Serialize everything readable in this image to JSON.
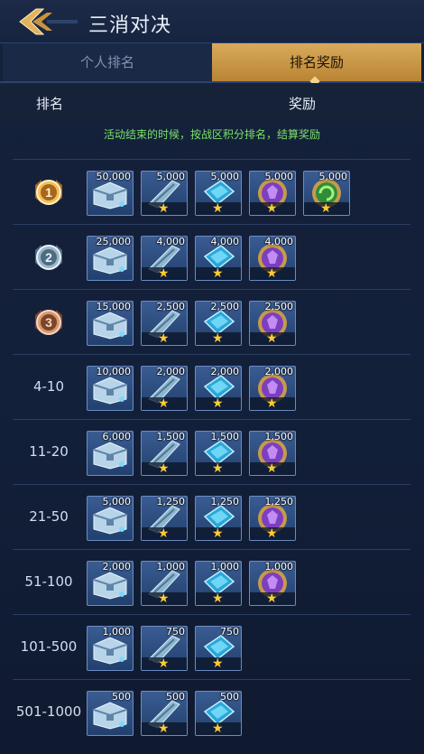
{
  "header": {
    "title": "三消对决",
    "back_icon": "back-arrow-icon"
  },
  "tabs": [
    {
      "label": "个人排名",
      "active": false
    },
    {
      "label": "排名奖励",
      "active": true
    }
  ],
  "columns": {
    "rank": "排名",
    "reward": "奖励"
  },
  "notice": "活动结束的时候，按战区积分排名，结算奖励",
  "colors": {
    "accent_gold": "#c8974a",
    "notice_green": "#7be06a",
    "star": "#ffcc33"
  },
  "rows": [
    {
      "rank": "1",
      "medal": "gold-medal-icon",
      "rewards": [
        {
          "icon": "treasure-chest-icon",
          "qty": "50,000",
          "star": false
        },
        {
          "icon": "wing-fragment-icon",
          "qty": "5,000",
          "star": true
        },
        {
          "icon": "blue-crystal-icon",
          "qty": "5,000",
          "star": true
        },
        {
          "icon": "purple-gem-icon",
          "qty": "5,000",
          "star": true
        },
        {
          "icon": "green-orb-icon",
          "qty": "5,000",
          "star": true
        }
      ]
    },
    {
      "rank": "2",
      "medal": "silver-medal-icon",
      "rewards": [
        {
          "icon": "treasure-chest-icon",
          "qty": "25,000",
          "star": false
        },
        {
          "icon": "wing-fragment-icon",
          "qty": "4,000",
          "star": true
        },
        {
          "icon": "blue-crystal-icon",
          "qty": "4,000",
          "star": true
        },
        {
          "icon": "purple-gem-icon",
          "qty": "4,000",
          "star": true
        }
      ]
    },
    {
      "rank": "3",
      "medal": "bronze-medal-icon",
      "rewards": [
        {
          "icon": "treasure-chest-icon",
          "qty": "15,000",
          "star": false
        },
        {
          "icon": "wing-fragment-icon",
          "qty": "2,500",
          "star": true
        },
        {
          "icon": "blue-crystal-icon",
          "qty": "2,500",
          "star": true
        },
        {
          "icon": "purple-gem-icon",
          "qty": "2,500",
          "star": true
        }
      ]
    },
    {
      "rank": "4-10",
      "rewards": [
        {
          "icon": "treasure-chest-icon",
          "qty": "10,000",
          "star": false
        },
        {
          "icon": "wing-fragment-icon",
          "qty": "2,000",
          "star": true
        },
        {
          "icon": "blue-crystal-icon",
          "qty": "2,000",
          "star": true
        },
        {
          "icon": "purple-gem-icon",
          "qty": "2,000",
          "star": true
        }
      ]
    },
    {
      "rank": "11-20",
      "rewards": [
        {
          "icon": "treasure-chest-icon",
          "qty": "6,000",
          "star": false
        },
        {
          "icon": "wing-fragment-icon",
          "qty": "1,500",
          "star": true
        },
        {
          "icon": "blue-crystal-icon",
          "qty": "1,500",
          "star": true
        },
        {
          "icon": "purple-gem-icon",
          "qty": "1,500",
          "star": true
        }
      ]
    },
    {
      "rank": "21-50",
      "rewards": [
        {
          "icon": "treasure-chest-icon",
          "qty": "5,000",
          "star": false
        },
        {
          "icon": "wing-fragment-icon",
          "qty": "1,250",
          "star": true
        },
        {
          "icon": "blue-crystal-icon",
          "qty": "1,250",
          "star": true
        },
        {
          "icon": "purple-gem-icon",
          "qty": "1,250",
          "star": true
        }
      ]
    },
    {
      "rank": "51-100",
      "rewards": [
        {
          "icon": "treasure-chest-icon",
          "qty": "2,000",
          "star": false
        },
        {
          "icon": "wing-fragment-icon",
          "qty": "1,000",
          "star": true
        },
        {
          "icon": "blue-crystal-icon",
          "qty": "1,000",
          "star": true
        },
        {
          "icon": "purple-gem-icon",
          "qty": "1,000",
          "star": true
        }
      ]
    },
    {
      "rank": "101-500",
      "rewards": [
        {
          "icon": "treasure-chest-icon",
          "qty": "1,000",
          "star": false
        },
        {
          "icon": "wing-fragment-icon",
          "qty": "750",
          "star": true
        },
        {
          "icon": "blue-crystal-icon",
          "qty": "750",
          "star": true
        }
      ]
    },
    {
      "rank": "501-1000",
      "rewards": [
        {
          "icon": "treasure-chest-icon",
          "qty": "500",
          "star": false
        },
        {
          "icon": "wing-fragment-icon",
          "qty": "500",
          "star": true
        },
        {
          "icon": "blue-crystal-icon",
          "qty": "500",
          "star": true
        }
      ]
    }
  ]
}
